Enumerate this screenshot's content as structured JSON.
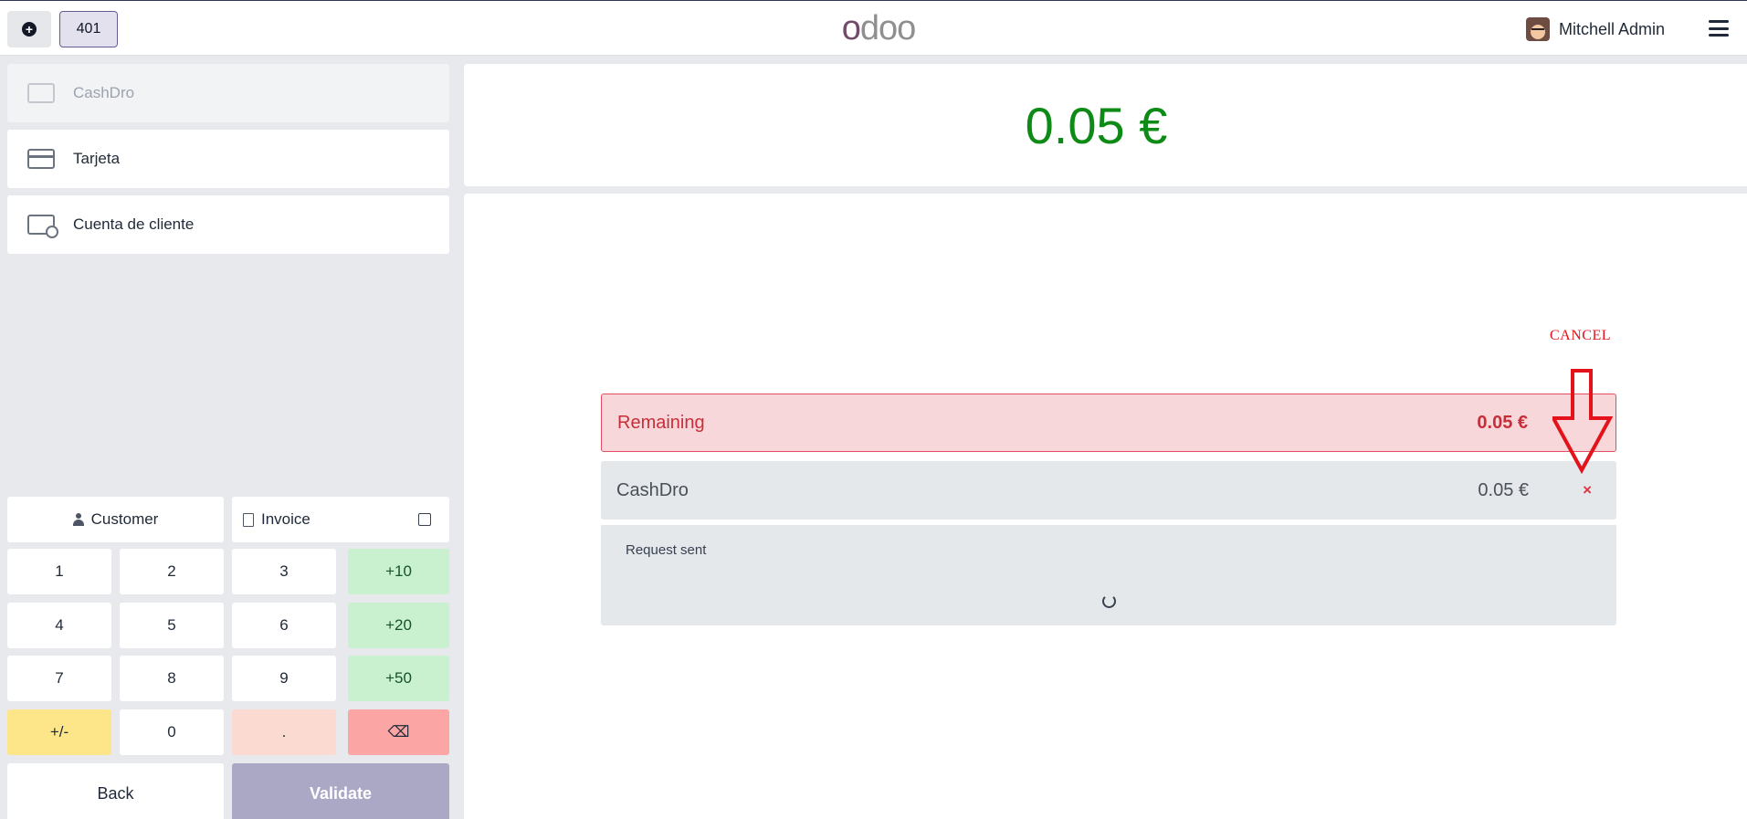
{
  "topbar": {
    "new_order_icon": "plus-circle-icon",
    "order_number": "401",
    "logo_text": "odoo",
    "user_name": "Mitchell Admin",
    "menu_icon": "hamburger-icon"
  },
  "payment_methods": [
    {
      "label": "CashDro",
      "icon": "cash-icon",
      "disabled": true
    },
    {
      "label": "Tarjeta",
      "icon": "card-icon",
      "disabled": false
    },
    {
      "label": "Cuenta de cliente",
      "icon": "customer-account-icon",
      "disabled": false
    }
  ],
  "options": {
    "customer_label": "Customer",
    "invoice_label": "Invoice",
    "invoice_checked": false
  },
  "numpad": {
    "keys": [
      "1",
      "2",
      "3",
      "+10",
      "4",
      "5",
      "6",
      "+20",
      "7",
      "8",
      "9",
      "+50",
      "+/-",
      "0",
      ".",
      "⌫"
    ]
  },
  "actions": {
    "back_label": "Back",
    "validate_label": "Validate"
  },
  "summary": {
    "total": "0.05 €"
  },
  "lines": {
    "remaining_label": "Remaining",
    "remaining_amount": "0.05 €",
    "payment_label": "CashDro",
    "payment_amount": "0.05 €",
    "remove_symbol": "×"
  },
  "status": {
    "message": "Request sent"
  },
  "annotation": {
    "cancel_label": "CANCEL",
    "arrow_color": "#e3121b"
  }
}
